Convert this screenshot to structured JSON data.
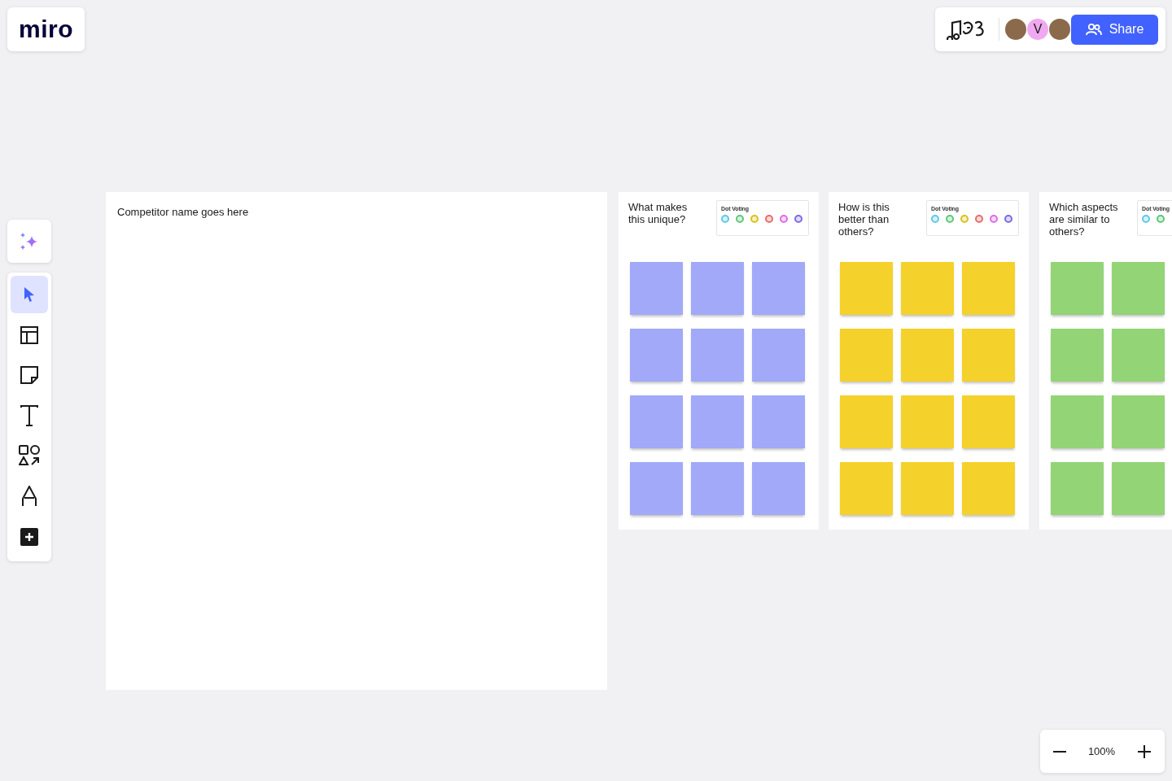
{
  "logo": "miro",
  "collaboration": {
    "avatars": [
      {
        "kind": "photo"
      },
      {
        "kind": "initial",
        "initial": "V",
        "color": "#f0a8f0"
      },
      {
        "kind": "photo"
      }
    ],
    "share_button": "Share"
  },
  "toolbar": {
    "tools": [
      {
        "kind": "select",
        "selected": true
      },
      {
        "kind": "templates",
        "selected": false
      },
      {
        "kind": "sticky",
        "selected": false
      },
      {
        "kind": "text",
        "selected": false
      },
      {
        "kind": "shapes",
        "selected": false
      },
      {
        "kind": "pen",
        "selected": false
      },
      {
        "kind": "add",
        "selected": false
      }
    ]
  },
  "frames": [
    {
      "kind": "title",
      "title": "Competitor name goes here"
    },
    {
      "kind": "notes",
      "question": "What makes this unique?",
      "voting_label": "Dot Voting",
      "dots": [
        {
          "color": "#5fc8e8"
        },
        {
          "color": "#5dc87a"
        },
        {
          "color": "#d9c21c"
        },
        {
          "color": "#ea6a6a"
        },
        {
          "color": "#e26ae2"
        },
        {
          "color": "#7d6ae8"
        }
      ],
      "notes": [
        {
          "color": "#a1a9f8"
        },
        {
          "color": "#a1a9f8"
        },
        {
          "color": "#a1a9f8"
        },
        {
          "color": "#a1a9f8"
        },
        {
          "color": "#a1a9f8"
        },
        {
          "color": "#a1a9f8"
        },
        {
          "color": "#a1a9f8"
        },
        {
          "color": "#a1a9f8"
        },
        {
          "color": "#a1a9f8"
        },
        {
          "color": "#a1a9f8"
        },
        {
          "color": "#a1a9f8"
        },
        {
          "color": "#a1a9f8"
        }
      ]
    },
    {
      "kind": "notes",
      "question": "How is this better than others?",
      "voting_label": "Dot Voting",
      "dots": [
        {
          "color": "#5fc8e8"
        },
        {
          "color": "#5dc87a"
        },
        {
          "color": "#d9c21c"
        },
        {
          "color": "#ea6a6a"
        },
        {
          "color": "#e26ae2"
        },
        {
          "color": "#7d6ae8"
        }
      ],
      "notes": [
        {
          "color": "#f5d12b"
        },
        {
          "color": "#f5d12b"
        },
        {
          "color": "#f5d12b"
        },
        {
          "color": "#f5d12b"
        },
        {
          "color": "#f5d12b"
        },
        {
          "color": "#f5d12b"
        },
        {
          "color": "#f5d12b"
        },
        {
          "color": "#f5d12b"
        },
        {
          "color": "#f5d12b"
        },
        {
          "color": "#f5d12b"
        },
        {
          "color": "#f5d12b"
        },
        {
          "color": "#f5d12b"
        }
      ]
    },
    {
      "kind": "notes",
      "question": "Which aspects are similar to others?",
      "voting_label": "Dot Voting",
      "dots": [
        {
          "color": "#5fc8e8"
        },
        {
          "color": "#5dc87a"
        }
      ],
      "notes": [
        {
          "color": "#93d477"
        },
        {
          "color": "#93d477"
        },
        {
          "color": "#93d477"
        },
        {
          "color": "#93d477"
        },
        {
          "color": "#93d477"
        },
        {
          "color": "#93d477"
        },
        {
          "color": "#93d477"
        },
        {
          "color": "#93d477"
        }
      ]
    }
  ],
  "zoom": {
    "value": "100%"
  }
}
